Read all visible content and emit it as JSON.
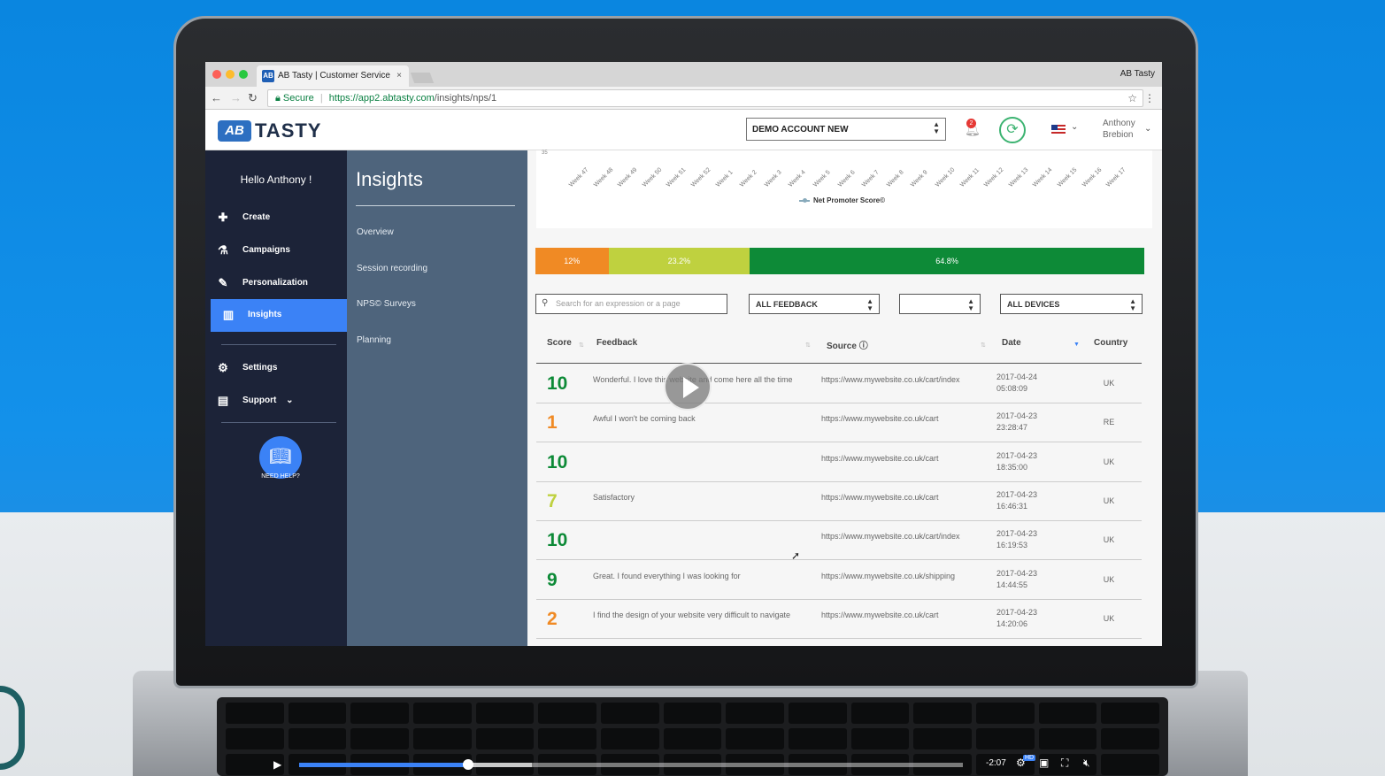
{
  "browser": {
    "tab_title": "AB Tasty | Customer Service",
    "tab_favicon": "AB",
    "window_title": "AB Tasty",
    "url_secure_label": "Secure",
    "url_host": "https://app2.abtasty.com",
    "url_path": "/insights/nps/1"
  },
  "header": {
    "logo_badge": "AB",
    "logo_text": "TASTY",
    "account_select": "DEMO ACCOUNT NEW",
    "notification_count": "2",
    "user_first": "Anthony",
    "user_last": "Brebion"
  },
  "sidebar": {
    "greeting": "Hello Anthony !",
    "items": [
      {
        "label": "Create"
      },
      {
        "label": "Campaigns"
      },
      {
        "label": "Personalization"
      },
      {
        "label": "Insights"
      },
      {
        "label": "Settings"
      },
      {
        "label": "Support"
      }
    ],
    "help_label": "NEED HELP?"
  },
  "submenu": {
    "title": "Insights",
    "items": [
      "Overview",
      "Session recording",
      "NPS© Surveys",
      "Planning"
    ]
  },
  "chart": {
    "tick": "35",
    "weeks": [
      "Week 47",
      "Week 48",
      "Week 49",
      "Week 50",
      "Week 51",
      "Week 52",
      "Week 1",
      "Week 2",
      "Week 3",
      "Week 4",
      "Week 5",
      "Week 6",
      "Week 7",
      "Week 8",
      "Week 9",
      "Week 10",
      "Week 11",
      "Week 12",
      "Week 13",
      "Week 14",
      "Week 15",
      "Week 16",
      "Week 17"
    ],
    "legend": "Net Promoter Score©"
  },
  "nps_bar": [
    {
      "label": "12%",
      "value": 12,
      "color": "#f08a24"
    },
    {
      "label": "23.2%",
      "value": 23.2,
      "color": "#bfd13f"
    },
    {
      "label": "64.8%",
      "value": 64.8,
      "color": "#0d8a37"
    }
  ],
  "filters": {
    "search_placeholder": "Search for an expression or a page",
    "feedback_select": "ALL FEEDBACK",
    "blank_select": "",
    "devices_select": "ALL DEVICES"
  },
  "table": {
    "headers": {
      "score": "Score",
      "feedback": "Feedback",
      "source": "Source",
      "date": "Date",
      "country": "Country"
    },
    "rows": [
      {
        "score": "10",
        "color": "#0d8a37",
        "feedback": "Wonderful. I love this website and come here all the time",
        "source": "https://www.mywebsite.co.uk/cart/index",
        "date1": "2017-04-24",
        "date2": "05:08:09",
        "country": "UK"
      },
      {
        "score": "1",
        "color": "#f08a24",
        "feedback": "Awful I won't be coming back",
        "source": "https://www.mywebsite.co.uk/cart",
        "date1": "2017-04-23",
        "date2": "23:28:47",
        "country": "RE"
      },
      {
        "score": "10",
        "color": "#0d8a37",
        "feedback": "",
        "source": "https://www.mywebsite.co.uk/cart",
        "date1": "2017-04-23",
        "date2": "18:35:00",
        "country": "UK"
      },
      {
        "score": "7",
        "color": "#bfd13f",
        "feedback": "Satisfactory",
        "source": "https://www.mywebsite.co.uk/cart",
        "date1": "2017-04-23",
        "date2": "16:46:31",
        "country": "UK"
      },
      {
        "score": "10",
        "color": "#0d8a37",
        "feedback": "",
        "source": "https://www.mywebsite.co.uk/cart/index",
        "date1": "2017-04-23",
        "date2": "16:19:53",
        "country": "UK"
      },
      {
        "score": "9",
        "color": "#0d8a37",
        "feedback": "Great. I found everything I was looking for",
        "source": "https://www.mywebsite.co.uk/shipping",
        "date1": "2017-04-23",
        "date2": "14:44:55",
        "country": "UK"
      },
      {
        "score": "2",
        "color": "#f08a24",
        "feedback": "I find the design of your website very difficult to navigate",
        "source": "https://www.mywebsite.co.uk/cart",
        "date1": "2017-04-23",
        "date2": "14:20:06",
        "country": "UK"
      }
    ]
  },
  "video": {
    "time_remaining": "-2:07",
    "hd_label": "HD",
    "progress": 0.255,
    "buffered": 0.35
  },
  "colors": {
    "brand": "#2d6fc1",
    "sidebar_bg": "#1c2338",
    "submenu_bg": "#4e647c",
    "active": "#3b82f6"
  }
}
